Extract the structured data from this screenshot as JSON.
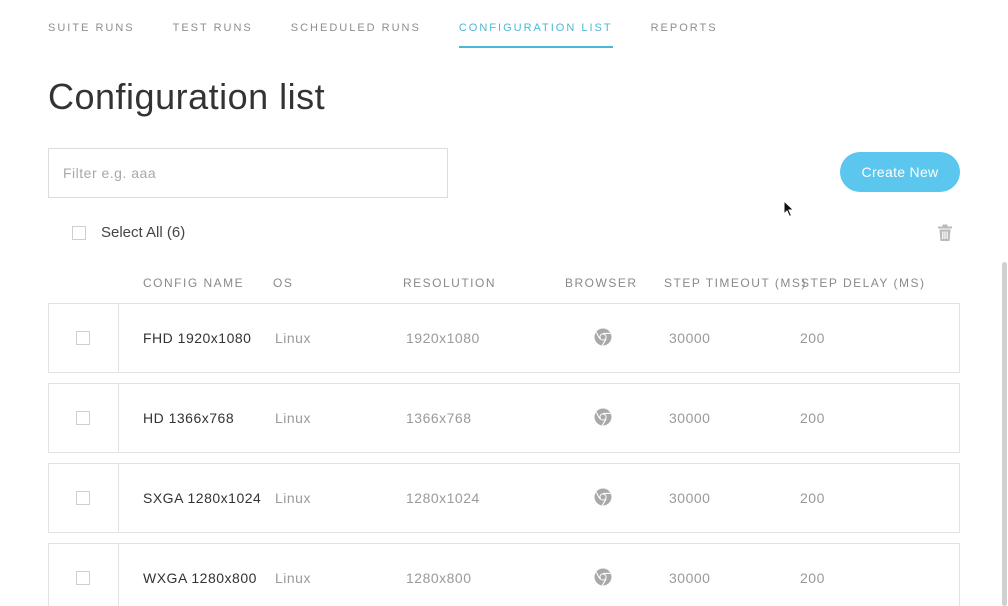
{
  "nav": {
    "items": [
      {
        "label": "SUITE RUNS",
        "active": false
      },
      {
        "label": "TEST RUNS",
        "active": false
      },
      {
        "label": "SCHEDULED RUNS",
        "active": false
      },
      {
        "label": "CONFIGURATION LIST",
        "active": true
      },
      {
        "label": "REPORTS",
        "active": false
      }
    ]
  },
  "page": {
    "title": "Configuration list"
  },
  "filter": {
    "placeholder": "Filter e.g. aaa",
    "value": ""
  },
  "toolbar": {
    "create_label": "Create New",
    "select_all_label": "Select All (6)",
    "delete_icon": "trash-icon"
  },
  "table": {
    "headers": {
      "name": "CONFIG NAME",
      "os": "OS",
      "resolution": "RESOLUTION",
      "browser": "BROWSER",
      "step_timeout": "STEP TIMEOUT (MS)",
      "step_delay": "STEP DELAY (MS)"
    },
    "rows": [
      {
        "name": "FHD 1920x1080",
        "os": "Linux",
        "resolution": "1920x1080",
        "browser": "chrome-icon",
        "step_timeout": "30000",
        "step_delay": "200"
      },
      {
        "name": "HD 1366x768",
        "os": "Linux",
        "resolution": "1366x768",
        "browser": "chrome-icon",
        "step_timeout": "30000",
        "step_delay": "200"
      },
      {
        "name": "SXGA 1280x1024",
        "os": "Linux",
        "resolution": "1280x1024",
        "browser": "chrome-icon",
        "step_timeout": "30000",
        "step_delay": "200"
      },
      {
        "name": "WXGA 1280x800",
        "os": "Linux",
        "resolution": "1280x800",
        "browser": "chrome-icon",
        "step_timeout": "30000",
        "step_delay": "200"
      }
    ]
  },
  "colors": {
    "accent": "#4bb8d6",
    "button": "#5bc6ee",
    "muted_text": "#9a9a9a",
    "border": "#e2e2e2"
  }
}
